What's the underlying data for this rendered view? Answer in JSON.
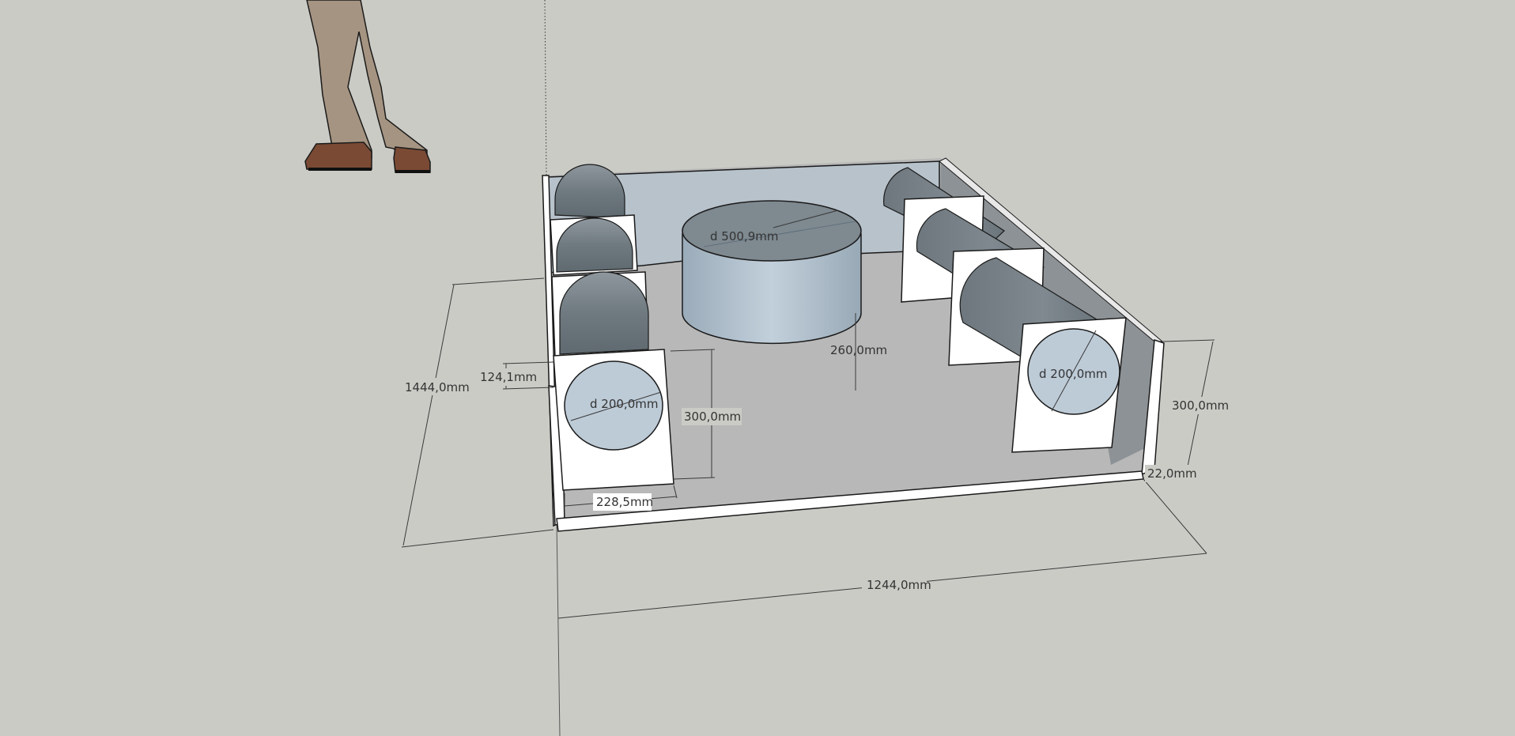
{
  "scene": {
    "background": "#cbcbc6",
    "floor_color": "#b8b8b8",
    "panel_color": "#ffffff",
    "tube_color": "#7f8a90",
    "cylinder_color": "#b7c6d2",
    "back_wall_color": "#b6c1ca",
    "person": "scale-figure-person"
  },
  "dimensions": {
    "width_overall": "1244,0mm",
    "depth_overall": "1444,0mm",
    "height_right": "300,0mm",
    "height_left_panel": "300,0mm",
    "panel_width": "228,5mm",
    "panel_offset": "124,1mm",
    "wall_thickness": "22,0mm",
    "cylinder_diameter": "d 500,9mm",
    "cylinder_height": "260,0mm",
    "left_port_diameter": "d 200,0mm",
    "right_port_diameter": "d 200,0mm"
  }
}
